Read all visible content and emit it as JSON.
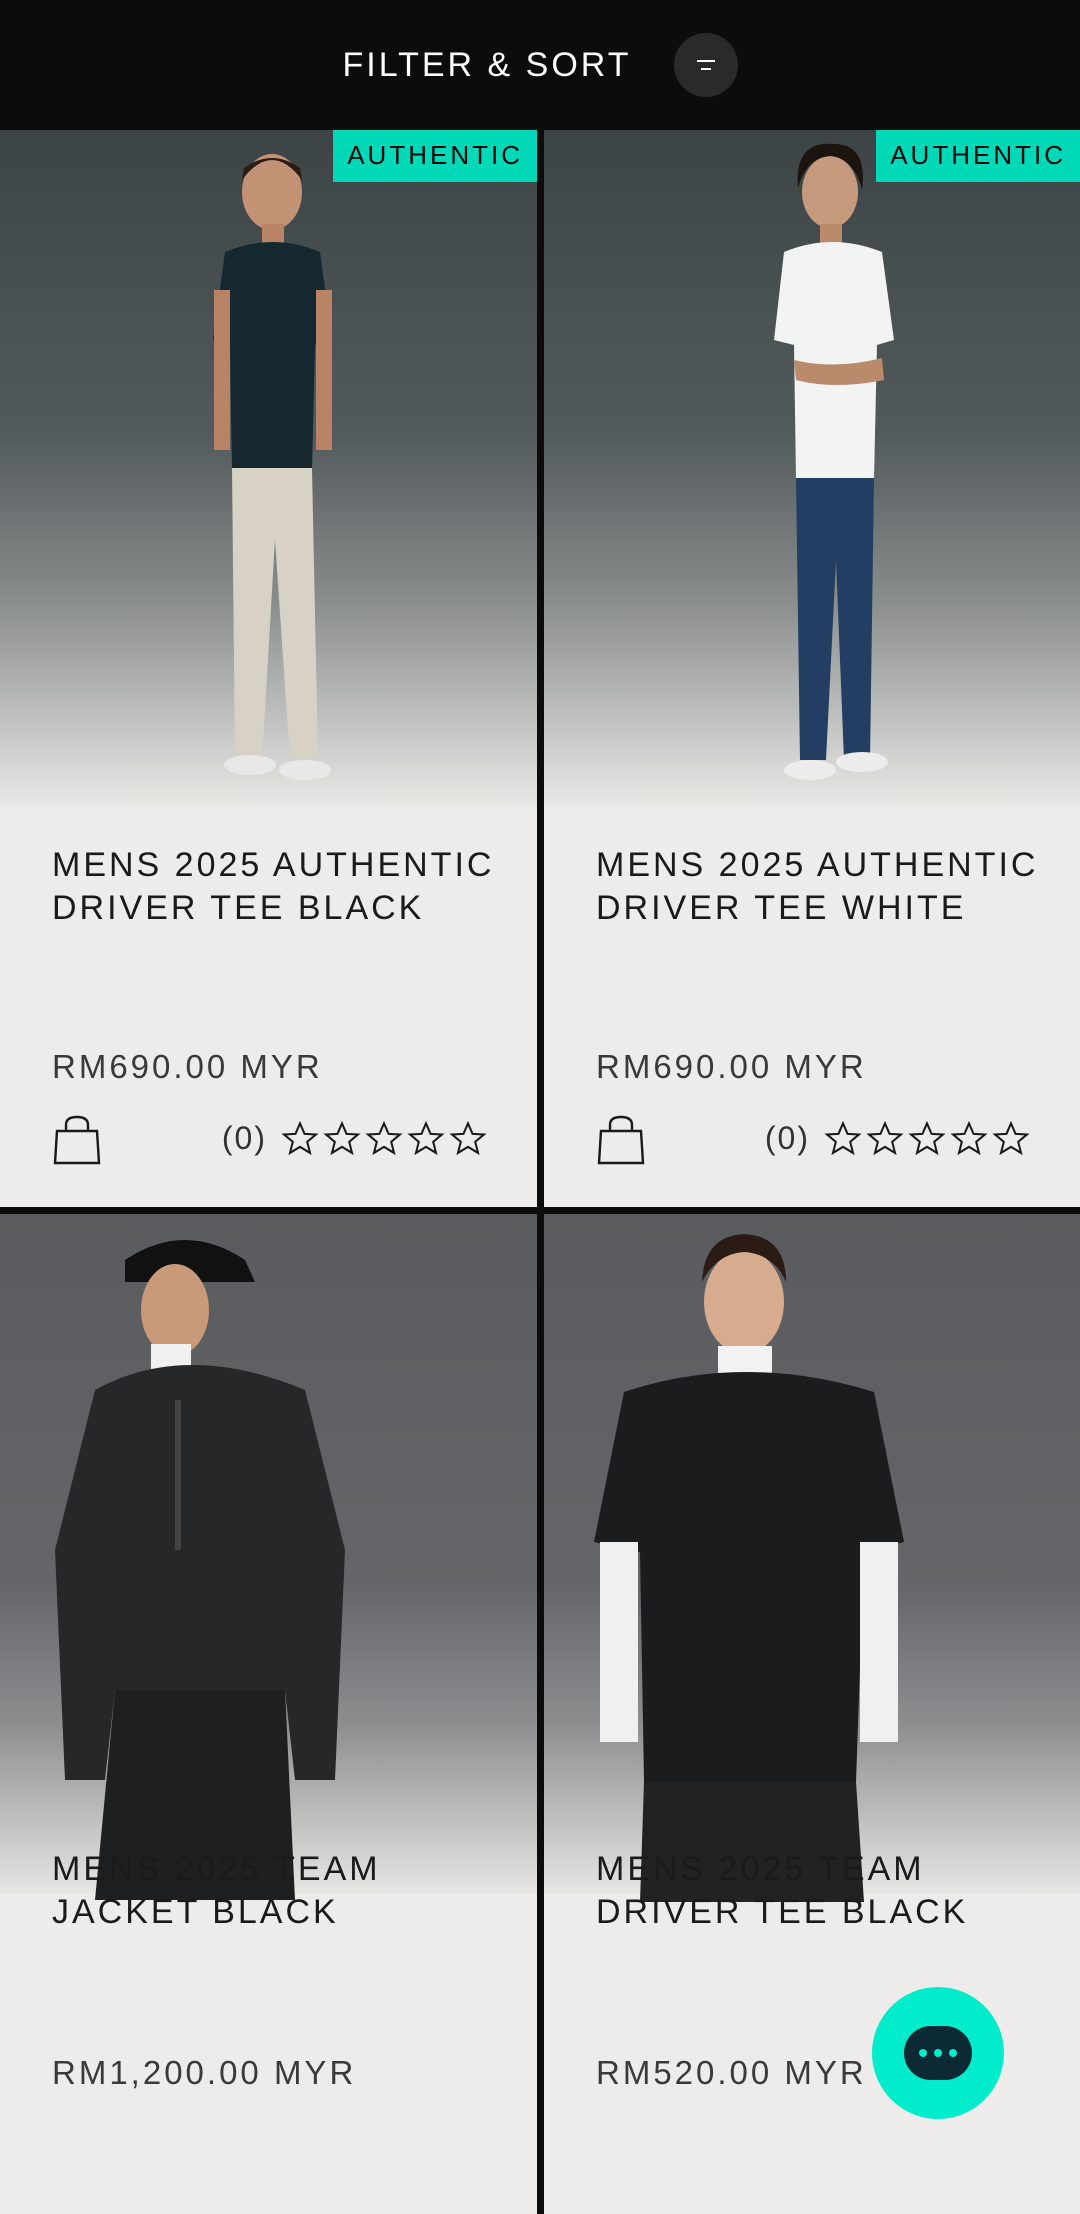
{
  "header": {
    "filter_label": "FILTER & SORT",
    "filter_icon": "filter-lines-icon"
  },
  "products": [
    {
      "badge": "AUTHENTIC",
      "title": "MENS 2025 AUTHENTIC DRIVER TEE BLACK",
      "price": "RM690.00 MYR",
      "review_count": "(0)",
      "stars": 0
    },
    {
      "badge": "AUTHENTIC",
      "title": "MENS 2025 AUTHENTIC DRIVER TEE WHITE",
      "price": "RM690.00 MYR",
      "review_count": "(0)",
      "stars": 0
    },
    {
      "title": "MENS 2025 TEAM JACKET BLACK",
      "price": "RM1,200.00 MYR"
    },
    {
      "title": "MENS 2025 TEAM DRIVER TEE BLACK",
      "price": "RM520.00 MYR"
    }
  ],
  "chat": {
    "icon": "chat-bubble-icon"
  },
  "colors": {
    "accent": "#00d9b8",
    "header_bg": "#0c0c0c",
    "card_bg": "#edecea"
  }
}
